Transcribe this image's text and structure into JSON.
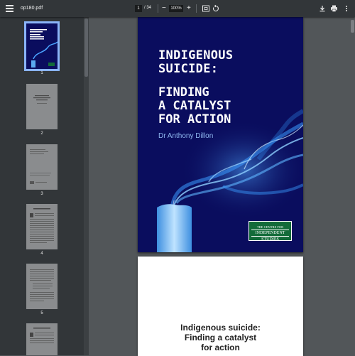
{
  "toolbar": {
    "filename": "op180.pdf",
    "current_page": "1",
    "page_count": "/ 34",
    "zoom": "100%",
    "zoom_out": "−",
    "zoom_in": "+"
  },
  "thumbnails": [
    {
      "label": "1"
    },
    {
      "label": "2"
    },
    {
      "label": "3"
    },
    {
      "label": "4"
    },
    {
      "label": "5"
    }
  ],
  "cover": {
    "title_line1": "INDIGENOUS",
    "title_line2": "SUICIDE:",
    "title_line3": "FINDING",
    "title_line4": "A CATALYST",
    "title_line5": "FOR ACTION",
    "author": "Dr Anthony Dillon",
    "logo_line1": "THE CENTRE FOR",
    "logo_line2": "INDEPENDENT",
    "logo_line3": "STUDIES"
  },
  "page2": {
    "title_line1": "Indigenous suicide:",
    "title_line2": "Finding a catalyst",
    "title_line3": "for action"
  },
  "colors": {
    "toolbar": "#323639",
    "cover_bg": "#0a0d5e",
    "accent": "#8ab4f8",
    "logo_green": "#136b39"
  }
}
